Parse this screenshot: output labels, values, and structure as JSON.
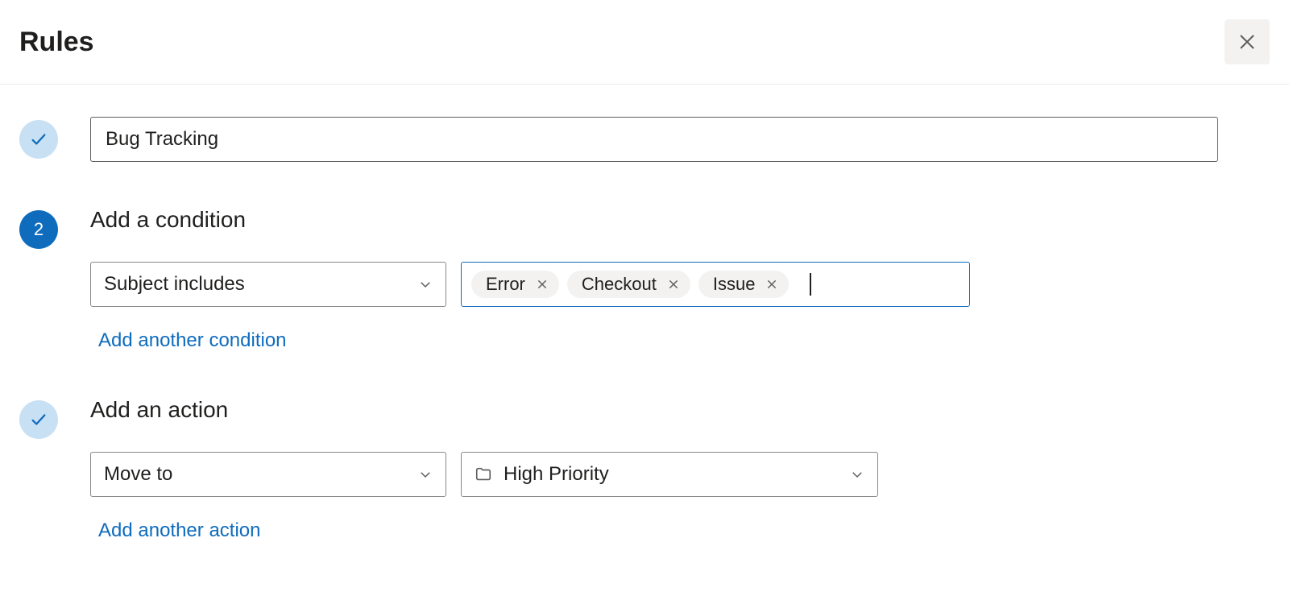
{
  "header": {
    "title": "Rules"
  },
  "step1": {
    "ruleName": "Bug Tracking"
  },
  "step2": {
    "number": "2",
    "title": "Add a condition",
    "conditionSelect": "Subject includes",
    "tags": [
      "Error",
      "Checkout",
      "Issue"
    ],
    "addLink": "Add another condition"
  },
  "step3": {
    "title": "Add an action",
    "actionSelect": "Move to",
    "folderSelect": "High Priority",
    "addLink": "Add another action"
  }
}
